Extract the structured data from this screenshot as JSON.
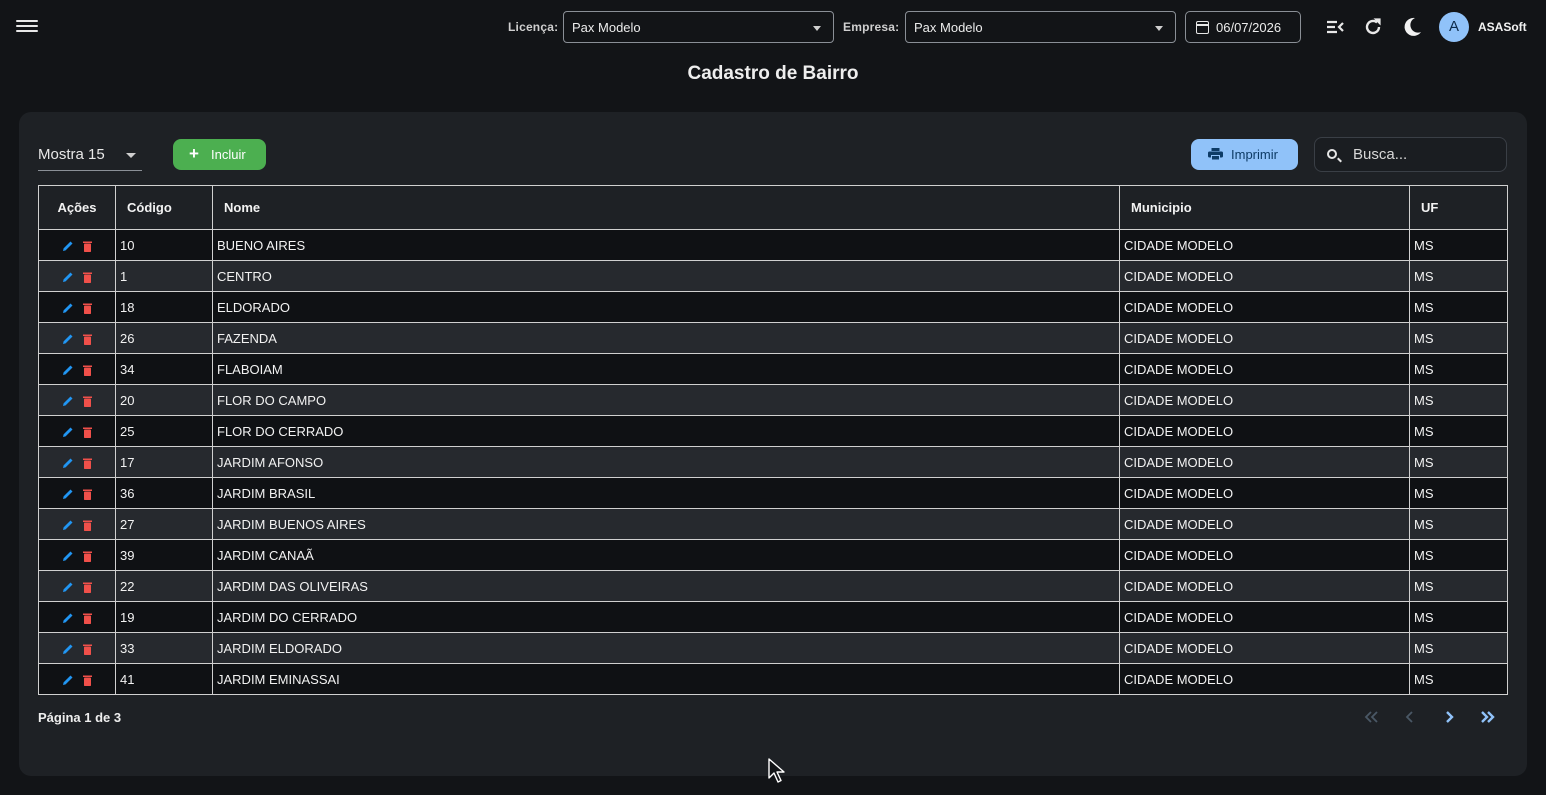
{
  "header": {
    "licenca_label": "Licença:",
    "licenca_value": "Pax Modelo",
    "empresa_label": "Empresa:",
    "empresa_value": "Pax Modelo",
    "date": "06/07/2026",
    "avatar_letter": "A",
    "user_name": "ASASoft"
  },
  "page": {
    "title": "Cadastro de Bairro"
  },
  "toolbar": {
    "show_label": "Mostra 15",
    "add_label": "Incluir",
    "print_label": "Imprimir",
    "search_placeholder": "Busca..."
  },
  "table": {
    "columns": [
      "Ações",
      "Código",
      "Nome",
      "Municipio",
      "UF"
    ],
    "rows": [
      {
        "codigo": "10",
        "nome": "BUENO AIRES",
        "municipio": "CIDADE MODELO",
        "uf": "MS"
      },
      {
        "codigo": "1",
        "nome": "CENTRO",
        "municipio": "CIDADE MODELO",
        "uf": "MS"
      },
      {
        "codigo": "18",
        "nome": "ELDORADO",
        "municipio": "CIDADE MODELO",
        "uf": "MS"
      },
      {
        "codigo": "26",
        "nome": "FAZENDA",
        "municipio": "CIDADE MODELO",
        "uf": "MS"
      },
      {
        "codigo": "34",
        "nome": "FLABOIAM",
        "municipio": "CIDADE MODELO",
        "uf": "MS"
      },
      {
        "codigo": "20",
        "nome": "FLOR DO CAMPO",
        "municipio": "CIDADE MODELO",
        "uf": "MS"
      },
      {
        "codigo": "25",
        "nome": "FLOR DO CERRADO",
        "municipio": "CIDADE MODELO",
        "uf": "MS"
      },
      {
        "codigo": "17",
        "nome": "JARDIM AFONSO",
        "municipio": "CIDADE MODELO",
        "uf": "MS"
      },
      {
        "codigo": "36",
        "nome": "JARDIM BRASIL",
        "municipio": "CIDADE MODELO",
        "uf": "MS"
      },
      {
        "codigo": "27",
        "nome": "JARDIM BUENOS AIRES",
        "municipio": "CIDADE MODELO",
        "uf": "MS"
      },
      {
        "codigo": "39",
        "nome": "JARDIM CANAÃ",
        "municipio": "CIDADE MODELO",
        "uf": "MS"
      },
      {
        "codigo": "22",
        "nome": "JARDIM DAS OLIVEIRAS",
        "municipio": "CIDADE MODELO",
        "uf": "MS"
      },
      {
        "codigo": "19",
        "nome": "JARDIM DO CERRADO",
        "municipio": "CIDADE MODELO",
        "uf": "MS"
      },
      {
        "codigo": "33",
        "nome": "JARDIM ELDORADO",
        "municipio": "CIDADE MODELO",
        "uf": "MS"
      },
      {
        "codigo": "41",
        "nome": "JARDIM EMINASSAI",
        "municipio": "CIDADE MODELO",
        "uf": "MS"
      }
    ]
  },
  "pagination": {
    "info": "Página 1 de 3"
  },
  "icons": {
    "menu": "hamburger-menu-icon",
    "calendar": "calendar-icon",
    "collapse": "collapse-menu-icon",
    "refresh": "refresh-icon",
    "theme": "dark-mode-moon-icon",
    "edit": "pencil-icon",
    "delete": "trash-icon",
    "print": "printer-icon",
    "search": "search-icon"
  },
  "colors": {
    "background": "#121417",
    "card": "#1e2125",
    "add_button": "#4caf50",
    "print_button": "#90c2f9",
    "edit_icon": "#2196f3",
    "delete_icon": "#f0504a",
    "pager_active": "#90c2f9",
    "pager_disabled": "#4a5866"
  }
}
